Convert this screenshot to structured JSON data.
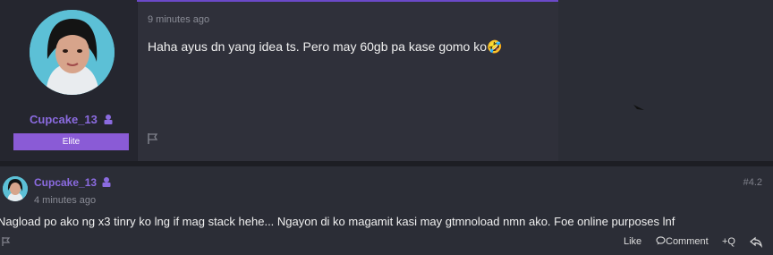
{
  "posts": [
    {
      "username": "Cupcake_13",
      "role": "Elite",
      "time": "9 minutes ago",
      "message": "Haha ayus dn yang idea ts. Pero may 60gb pa kase gomo ko",
      "emoji": "🤣"
    },
    {
      "username": "Cupcake_13",
      "time": "4 minutes ago",
      "post_number": "#4.2",
      "message": "Nagload po ako ng x3 tinry ko lng if mag stack hehe... Ngayon di ko magamit kasi may gtmnoload nmn ako. Foe online purposes lnf",
      "actions": {
        "like": "Like",
        "comment": "Comment",
        "quote": "+Q"
      }
    }
  ],
  "colors": {
    "accent": "#8b6be0",
    "badge": "#8a5bd6",
    "background": "#2b2d36"
  }
}
